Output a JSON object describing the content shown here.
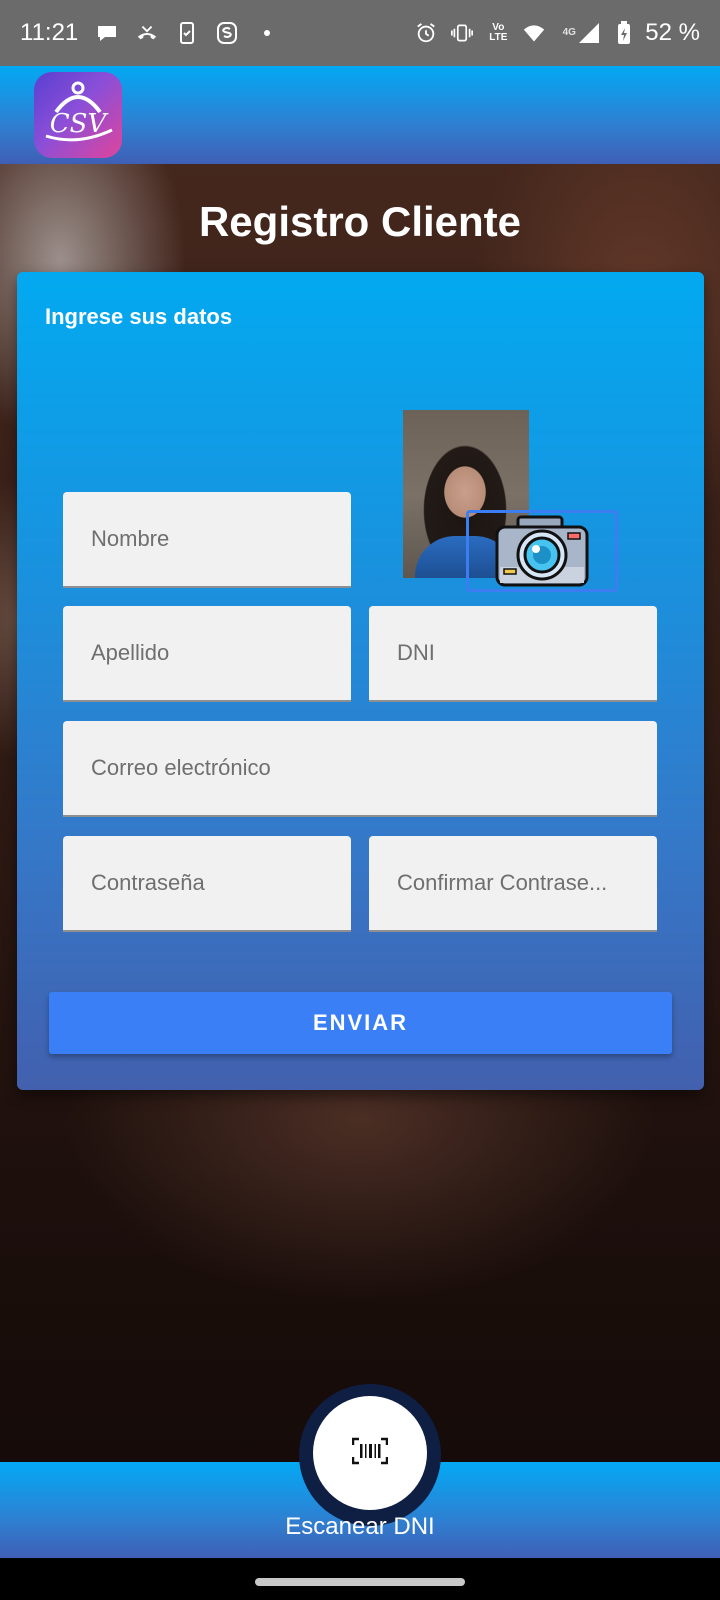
{
  "status_bar": {
    "time": "11:21",
    "battery": "52 %",
    "network": "4G",
    "volte": "Vo LTE",
    "icons": [
      "chat-icon",
      "missed-call-icon",
      "phone-check-icon",
      "s-app-icon",
      "dot-icon",
      "alarm-icon",
      "vibrate-icon",
      "volte-icon",
      "wifi-icon",
      "signal-icon",
      "battery-charging-icon"
    ]
  },
  "app_bar": {
    "logo_text": "CSV"
  },
  "page": {
    "title": "Registro Cliente"
  },
  "form": {
    "subtitle": "Ingrese sus datos",
    "fields": {
      "nombre": "Nombre",
      "apellido": "Apellido",
      "dni": "DNI",
      "correo": "Correo electrónico",
      "password": "Contraseña",
      "confirm_password": "Confirmar Contrase..."
    },
    "submit_label": "ENVIAR"
  },
  "bottom": {
    "scan_label": "Escanear DNI"
  },
  "colors": {
    "accent": "#3a7ff5",
    "card_top": "#03a9f0",
    "card_bottom": "#4260ae"
  }
}
